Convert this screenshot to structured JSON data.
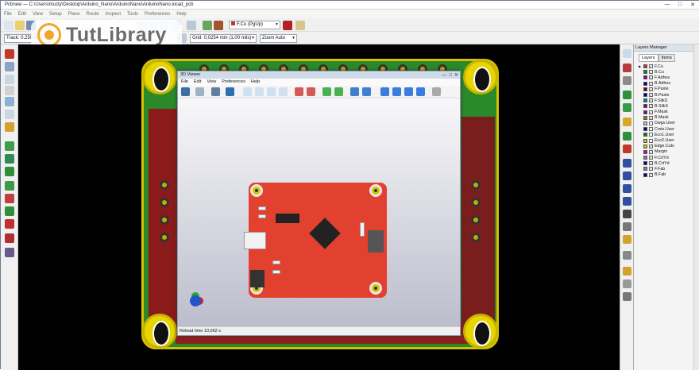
{
  "window": {
    "title": "Pcbnew — C:\\Users\\muzty\\Desktop\\Arduino_Nano\\ArduinoNano\\ArduinoNano.kicad_pcb",
    "minimize": "—",
    "maximize": "□",
    "close": "✕"
  },
  "menu": [
    "File",
    "Edit",
    "View",
    "Setup",
    "Place",
    "Route",
    "Inspect",
    "Tools",
    "Preferences",
    "Help"
  ],
  "toolbar": {
    "layer_select": "F.Cu (PgUp)",
    "track_width": "Track: 0.250 mm",
    "grid": "Grid: 0,0254 mm (1,00 mils)",
    "zoom": "Zoom Auto"
  },
  "logo": {
    "text": "TutLibrary",
    "color": "#f3a62a"
  },
  "layers_manager": {
    "title": "Layers Manager",
    "tabs": [
      "Layers",
      "Items"
    ],
    "layers": [
      {
        "name": "F.Cu",
        "color": "#c83434",
        "checked": true,
        "active": true
      },
      {
        "name": "B.Cu",
        "color": "#009900",
        "checked": true
      },
      {
        "name": "F.Adhes",
        "color": "#840084",
        "checked": true
      },
      {
        "name": "B.Adhes",
        "color": "#000084",
        "checked": true
      },
      {
        "name": "F.Paste",
        "color": "#840000",
        "checked": true
      },
      {
        "name": "B.Paste",
        "color": "#000084",
        "checked": true
      },
      {
        "name": "F.SilkS",
        "color": "#008484",
        "checked": true
      },
      {
        "name": "B.SilkS",
        "color": "#840084",
        "checked": true
      },
      {
        "name": "F.Mask",
        "color": "#840084",
        "checked": true
      },
      {
        "name": "B.Mask",
        "color": "#848400",
        "checked": true
      },
      {
        "name": "Dwgs.User",
        "color": "#c2c2c2",
        "checked": false
      },
      {
        "name": "Cmts.User",
        "color": "#000084",
        "checked": false
      },
      {
        "name": "Eco1.User",
        "color": "#008400",
        "checked": false
      },
      {
        "name": "Eco2.User",
        "color": "#c2c200",
        "checked": false
      },
      {
        "name": "Edge.Cuts",
        "color": "#c2c200",
        "checked": true
      },
      {
        "name": "Margin",
        "color": "#c200c2",
        "checked": true
      },
      {
        "name": "F.CrtYd",
        "color": "#848484",
        "checked": true
      },
      {
        "name": "B.CrtYd",
        "color": "#000084",
        "checked": true
      },
      {
        "name": "F.Fab",
        "color": "#848484",
        "checked": true
      },
      {
        "name": "B.Fab",
        "color": "#000084",
        "checked": true
      }
    ]
  },
  "viewer3d": {
    "title": "3D Viewer",
    "menu": [
      "File",
      "Edit",
      "View",
      "Preferences",
      "Help"
    ],
    "status": "Reload time 10,062 s"
  }
}
